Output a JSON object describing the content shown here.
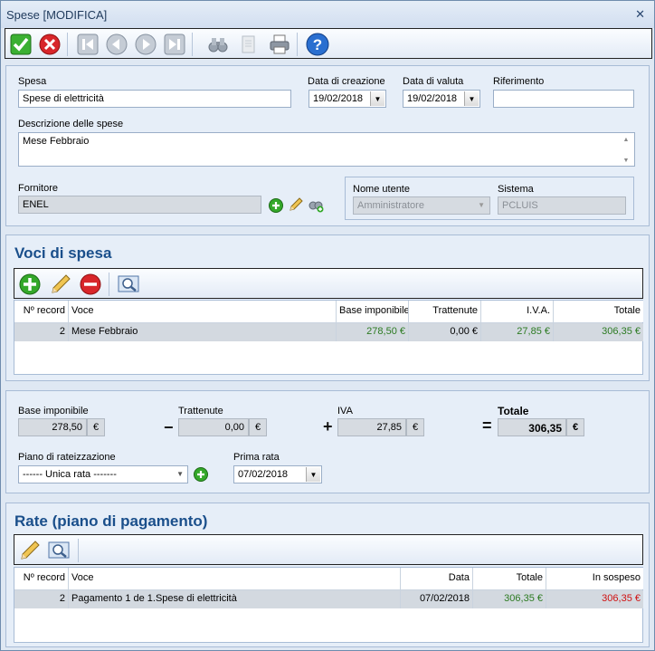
{
  "window": {
    "title": "Spese [MODIFICA]",
    "close_glyph": "✕"
  },
  "toolbar": {
    "icons": [
      "confirm-icon",
      "cancel-icon",
      "first-record-icon",
      "previous-record-icon",
      "next-record-icon",
      "last-record-icon",
      "binoculars-icon",
      "copy-icon",
      "print-icon",
      "help-icon"
    ]
  },
  "header": {
    "spesa_label": "Spesa",
    "spesa_value": "Spese di elettricità",
    "data_creazione_label": "Data di creazione",
    "data_creazione_value": "19/02/2018",
    "data_valuta_label": "Data di valuta",
    "data_valuta_value": "19/02/2018",
    "riferimento_label": "Riferimento",
    "riferimento_value": "",
    "descrizione_label": "Descrizione delle spese",
    "descrizione_value": "Mese Febbraio",
    "fornitore_label": "Fornitore",
    "fornitore_value": "ENEL",
    "nome_utente_label": "Nome utente",
    "nome_utente_value": "Amministratore",
    "sistema_label": "Sistema",
    "sistema_value": "PCLUIS"
  },
  "voci": {
    "title": "Voci di spesa",
    "columns": [
      "Nº record",
      "Voce",
      "Base imponibile",
      "Trattenute",
      "I.V.A.",
      "Totale"
    ],
    "rows": [
      {
        "record": "2",
        "voce": "Mese Febbraio",
        "base": "278,50 €",
        "trattenute": "0,00 €",
        "iva": "27,85 €",
        "totale": "306,35 €"
      }
    ]
  },
  "totals": {
    "base_label": "Base imponibile",
    "base_value": "278,50",
    "trattenute_label": "Trattenute",
    "trattenute_value": "0,00",
    "iva_label": "IVA",
    "iva_value": "27,85",
    "totale_label": "Totale",
    "totale_value": "306,35",
    "currency": "€",
    "minus": "−",
    "plus": "+",
    "equals": "=",
    "piano_label": "Piano di rateizzazione",
    "piano_value": "------ Unica rata -------",
    "prima_rata_label": "Prima rata",
    "prima_rata_value": "07/02/2018"
  },
  "rate": {
    "title": "Rate (piano di pagamento)",
    "columns": [
      "Nº record",
      "Voce",
      "Data",
      "Totale",
      "In sospeso"
    ],
    "rows": [
      {
        "record": "2",
        "voce": "Pagamento 1 de 1.Spese di elettricità",
        "data": "07/02/2018",
        "totale": "306,35 €",
        "sospeso": "306,35 €"
      }
    ]
  },
  "colors": {
    "accent_title": "#1a4f8b",
    "positive": "#2b7a20",
    "negative": "#d01010"
  }
}
